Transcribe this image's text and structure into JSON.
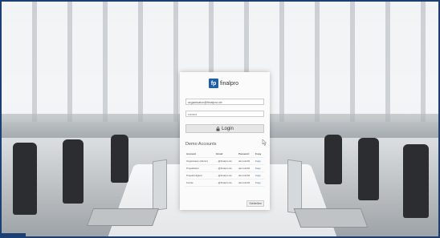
{
  "brand": {
    "mark": "fp",
    "name": "finalpro"
  },
  "login": {
    "email_value": "organisator@finalpro.de",
    "password_value": "••••••••",
    "button_label": "Login",
    "button_icon": "lock-icon"
  },
  "demo": {
    "title": "Demo Accounts",
    "headers": [
      "Account",
      "Email",
      "Passwort",
      "Copy"
    ],
    "rows": [
      [
        "Organisator (Admin)",
        "...@finalpro.de",
        "demo1234",
        "Copy"
      ],
      [
        "Projektleiter",
        "...@finalpro.de",
        "demo1234",
        "Copy"
      ],
      [
        "Projektmitglied",
        "...@finalpro.de",
        "demo1234",
        "Copy"
      ],
      [
        "Kunde",
        "...@finalpro.de",
        "demo1234",
        "Copy"
      ]
    ],
    "footer_button": "Schließen"
  },
  "colors": {
    "brand_blue": "#1f5fa8",
    "frame": "#1b3f72"
  }
}
